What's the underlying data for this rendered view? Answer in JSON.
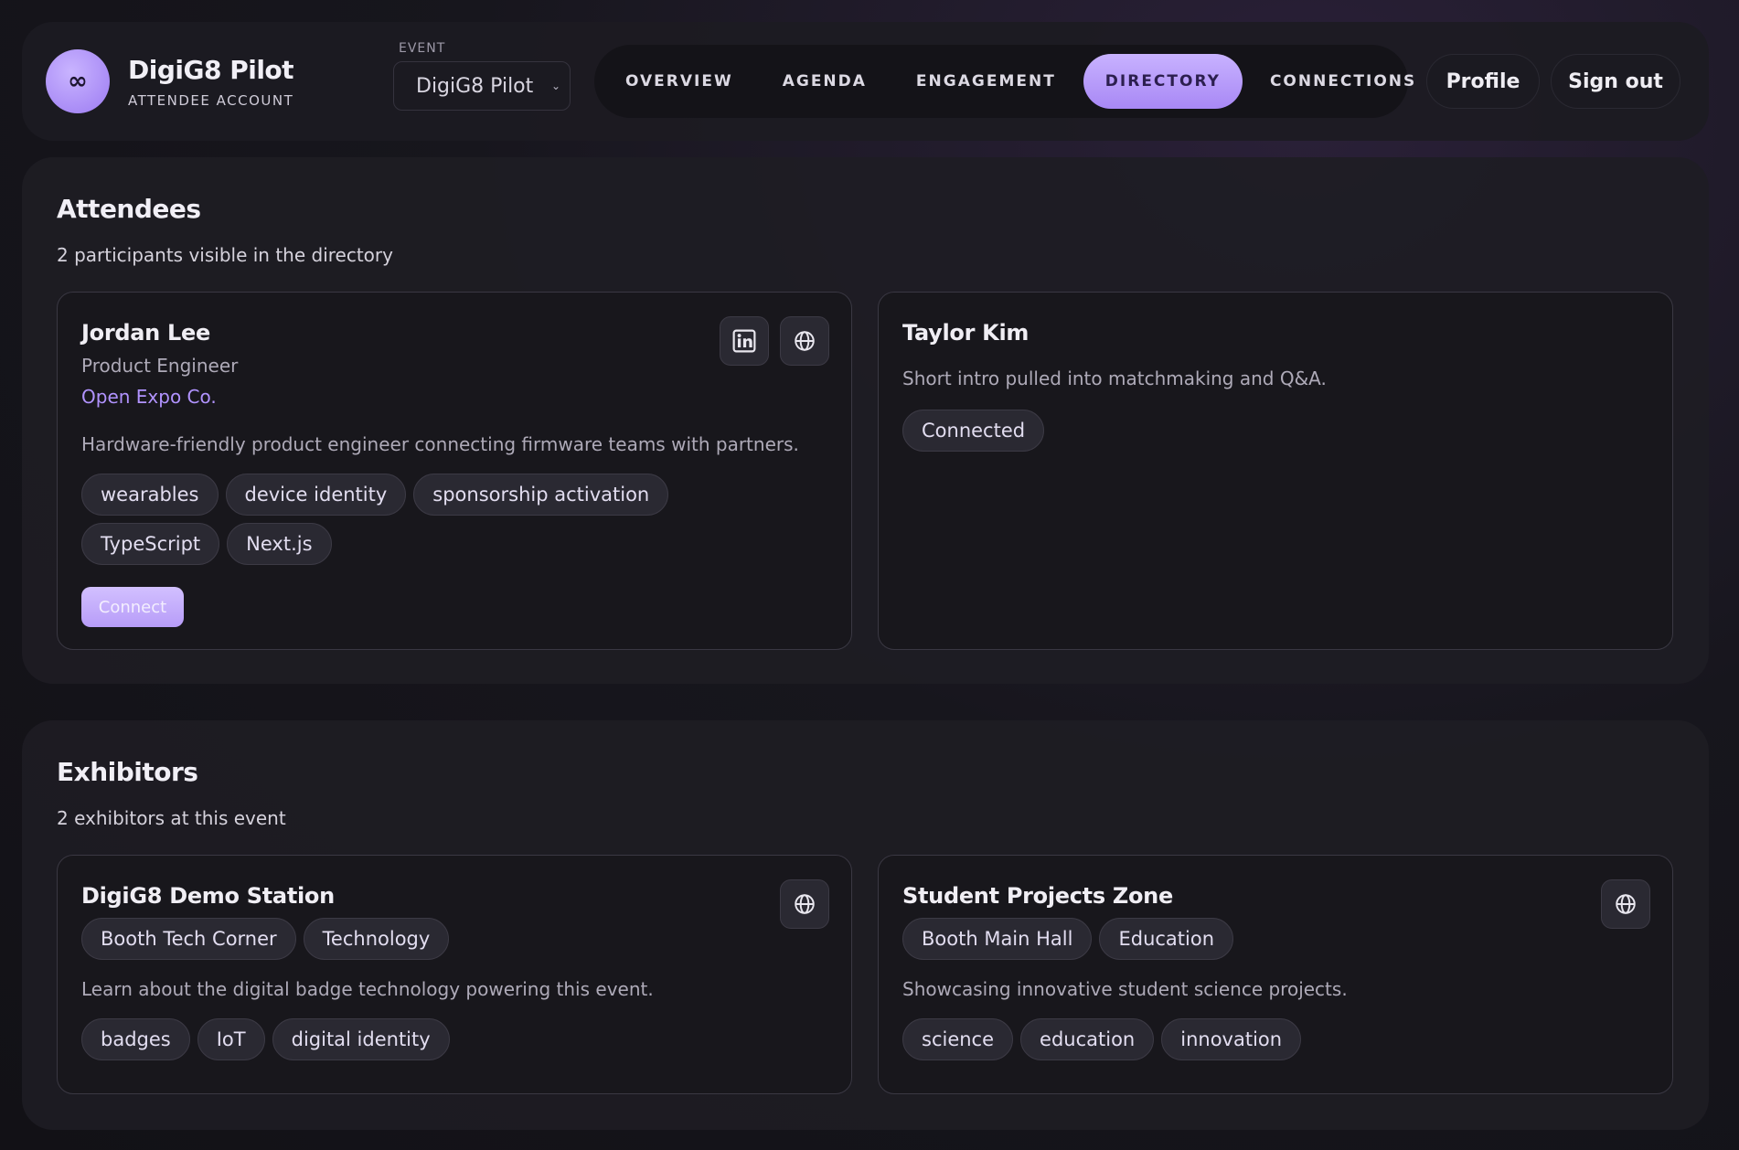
{
  "header": {
    "logo_glyph": "∞",
    "brand_title": "DigiG8 Pilot",
    "brand_subtitle": "ATTENDEE ACCOUNT",
    "event_label": "EVENT",
    "event_selected": "DigiG8 Pilot",
    "nav": [
      {
        "label": "OVERVIEW",
        "active": false
      },
      {
        "label": "AGENDA",
        "active": false
      },
      {
        "label": "ENGAGEMENT",
        "active": false
      },
      {
        "label": "DIRECTORY",
        "active": true
      },
      {
        "label": "CONNECTIONS",
        "active": false
      }
    ],
    "profile_label": "Profile",
    "signout_label": "Sign out"
  },
  "attendees": {
    "title": "Attendees",
    "subtitle": "2 participants visible in the directory",
    "cards": [
      {
        "name": "Jordan Lee",
        "role": "Product Engineer",
        "company": "Open Expo Co.",
        "description": "Hardware-friendly product engineer connecting firmware teams with partners.",
        "tags": [
          "wearables",
          "device identity",
          "sponsorship activation",
          "TypeScript",
          "Next.js"
        ],
        "action_label": "Connect",
        "icons": [
          "linkedin-icon",
          "globe-icon"
        ]
      },
      {
        "name": "Taylor Kim",
        "description": "Short intro pulled into matchmaking and Q&A.",
        "status": "Connected"
      }
    ]
  },
  "exhibitors": {
    "title": "Exhibitors",
    "subtitle": "2 exhibitors at this event",
    "cards": [
      {
        "name": "DigiG8 Demo Station",
        "badges": [
          "Booth Tech Corner",
          "Technology"
        ],
        "description": "Learn about the digital badge technology powering this event.",
        "tags": [
          "badges",
          "IoT",
          "digital identity"
        ],
        "icons": [
          "globe-icon"
        ]
      },
      {
        "name": "Student Projects Zone",
        "badges": [
          "Booth Main Hall",
          "Education"
        ],
        "description": "Showcasing innovative student science projects.",
        "tags": [
          "science",
          "education",
          "innovation"
        ],
        "icons": [
          "globe-icon"
        ]
      }
    ]
  },
  "colors": {
    "accent": "#b193ff",
    "active_nav": "#a888f5",
    "background": "#17161d"
  }
}
